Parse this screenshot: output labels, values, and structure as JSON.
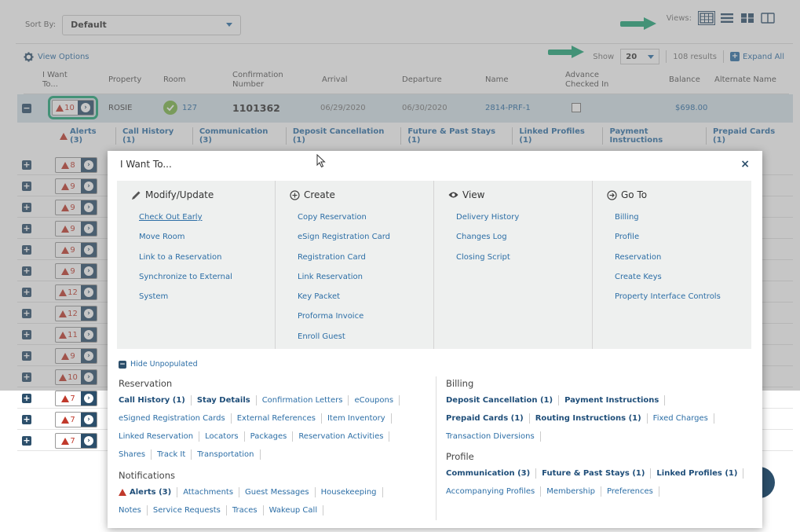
{
  "toolbar": {
    "sort_by_label": "Sort By:",
    "sort_by_value": "Default",
    "views_label": "Views:",
    "view_options_label": "View Options",
    "show_label": "Show",
    "show_value": "20",
    "results_text": "108 results",
    "expand_all_label": "Expand All"
  },
  "table": {
    "columns": [
      "I Want To...",
      "Property",
      "Room",
      "Confirmation Number",
      "Arrival",
      "Departure",
      "Name",
      "Advance Checked In",
      "Balance",
      "Alternate Name"
    ],
    "expanded_row": {
      "alert_count": "10",
      "property": "ROSIE",
      "room": "127",
      "confirmation_number": "1101362",
      "arrival": "06/29/2020",
      "departure": "06/30/2020",
      "name": "2814-PRF-1",
      "balance": "$698.00"
    },
    "detail_tabs": [
      "Alerts (3)",
      "Call History (1)",
      "Communication (3)",
      "Deposit Cancellation (1)",
      "Future & Past Stays (1)",
      "Linked Profiles (1)",
      "Payment Instructions",
      "Prepaid Cards (1)"
    ],
    "row_alert_counts": [
      "8",
      "9",
      "9",
      "9",
      "9",
      "9",
      "12",
      "12",
      "11",
      "9",
      "10",
      "7",
      "7",
      "7"
    ]
  },
  "modal": {
    "title": "I Want To...",
    "close_label": "×",
    "columns": [
      {
        "heading": "Modify/Update",
        "items": [
          "Check Out Early",
          "Move Room",
          "Link to a Reservation",
          "Synchronize to External System"
        ]
      },
      {
        "heading": "Create",
        "items": [
          "Copy Reservation",
          "eSign Registration Card",
          "Registration Card",
          "Link Reservation",
          "Key Packet",
          "Proforma Invoice",
          "Enroll Guest"
        ]
      },
      {
        "heading": "View",
        "items": [
          "Delivery History",
          "Changes Log",
          "Closing Script"
        ]
      },
      {
        "heading": "Go To",
        "items": [
          "Billing",
          "Profile",
          "Reservation",
          "Create Keys",
          "Property Interface Controls"
        ]
      }
    ],
    "hide_unpopulated_label": "Hide Unpopulated",
    "reservation": {
      "title": "Reservation",
      "line1": [
        "Call History (1)",
        "Stay Details",
        "Confirmation Letters",
        "eCoupons"
      ],
      "line2": [
        "eSigned Registration Cards",
        "External References",
        "Item Inventory"
      ],
      "line3": [
        "Linked Reservation",
        "Locators",
        "Packages",
        "Reservation Activities"
      ],
      "line4": [
        "Shares",
        "Track It",
        "Transportation"
      ]
    },
    "notifications": {
      "title": "Notifications",
      "line1": [
        "Alerts (3)",
        "Attachments",
        "Guest Messages",
        "Housekeeping"
      ],
      "line2": [
        "Notes",
        "Service Requests",
        "Traces",
        "Wakeup Call"
      ]
    },
    "billing": {
      "title": "Billing",
      "line1": [
        "Deposit Cancellation (1)",
        "Payment Instructions"
      ],
      "line2": [
        "Prepaid Cards (1)",
        "Routing Instructions (1)",
        "Fixed Charges"
      ],
      "line3": [
        "Transaction Diversions"
      ]
    },
    "profile": {
      "title": "Profile",
      "line1": [
        "Communication (3)",
        "Future & Past Stays (1)",
        "Linked Profiles (1)"
      ],
      "line2": [
        "Accompanying Profiles",
        "Membership",
        "Preferences"
      ]
    }
  },
  "colors": {
    "accent_green": "#1ea578",
    "link_blue": "#2c6ea6",
    "dark_blue": "#2c4f6b",
    "alert_red": "#c0392b",
    "selected_row": "#d6e3ea"
  }
}
